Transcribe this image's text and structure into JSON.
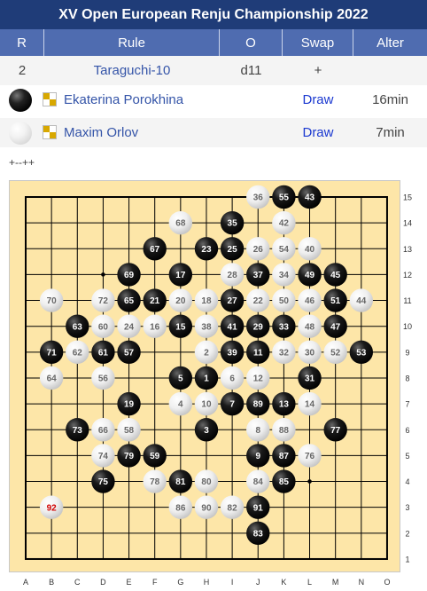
{
  "title": "XV Open European Renju Championship 2022",
  "headers": [
    "R",
    "Rule",
    "O",
    "Swap",
    "Alter"
  ],
  "info_row": {
    "round": "2",
    "rule": "Taraguchi-10",
    "opening": "d11",
    "swap": "+",
    "alter": ""
  },
  "players": [
    {
      "color": "black",
      "name": "Ekaterina Porokhina",
      "result": "Draw",
      "time": "16min"
    },
    {
      "color": "white",
      "name": "Maxim Orlov",
      "result": "Draw",
      "time": "7min"
    }
  ],
  "controls": {
    "expand": "+--++"
  },
  "board": {
    "columns": [
      "A",
      "B",
      "C",
      "D",
      "E",
      "F",
      "G",
      "H",
      "I",
      "J",
      "K",
      "L",
      "M",
      "N",
      "O"
    ],
    "rows": [
      "15",
      "14",
      "13",
      "12",
      "11",
      "10",
      "9",
      "8",
      "7",
      "6",
      "5",
      "4",
      "3",
      "2",
      "1"
    ],
    "colors": {
      "board_bg": "#fde6a8",
      "line": "#000000",
      "black_stone": "#111111",
      "white_stone": "#f0f0f0",
      "last_move_text": "#d00000"
    },
    "star_points": [
      "D12",
      "L12",
      "H8",
      "D4",
      "L4"
    ],
    "moves": [
      {
        "n": 1,
        "pos": "h8"
      },
      {
        "n": 2,
        "pos": "h9"
      },
      {
        "n": 3,
        "pos": "h6"
      },
      {
        "n": 4,
        "pos": "g7"
      },
      {
        "n": 5,
        "pos": "g8"
      },
      {
        "n": 6,
        "pos": "i8"
      },
      {
        "n": 7,
        "pos": "i7"
      },
      {
        "n": 8,
        "pos": "j6"
      },
      {
        "n": 9,
        "pos": "j5"
      },
      {
        "n": 10,
        "pos": "h7"
      },
      {
        "n": 11,
        "pos": "j9"
      },
      {
        "n": 12,
        "pos": "j8"
      },
      {
        "n": 13,
        "pos": "k7"
      },
      {
        "n": 14,
        "pos": "l7"
      },
      {
        "n": 15,
        "pos": "g10"
      },
      {
        "n": 16,
        "pos": "f10"
      },
      {
        "n": 17,
        "pos": "g12"
      },
      {
        "n": 18,
        "pos": "h11"
      },
      {
        "n": 19,
        "pos": "e7"
      },
      {
        "n": 20,
        "pos": "g11"
      },
      {
        "n": 21,
        "pos": "f11"
      },
      {
        "n": 22,
        "pos": "j11"
      },
      {
        "n": 23,
        "pos": "h13"
      },
      {
        "n": 24,
        "pos": "e10"
      },
      {
        "n": 25,
        "pos": "i13"
      },
      {
        "n": 26,
        "pos": "j13"
      },
      {
        "n": 27,
        "pos": "i11"
      },
      {
        "n": 28,
        "pos": "i12"
      },
      {
        "n": 29,
        "pos": "j10"
      },
      {
        "n": 30,
        "pos": "l9"
      },
      {
        "n": 31,
        "pos": "l8"
      },
      {
        "n": 32,
        "pos": "k9"
      },
      {
        "n": 33,
        "pos": "k10"
      },
      {
        "n": 34,
        "pos": "k12"
      },
      {
        "n": 35,
        "pos": "i14"
      },
      {
        "n": 36,
        "pos": "j15"
      },
      {
        "n": 37,
        "pos": "j12"
      },
      {
        "n": 38,
        "pos": "h10"
      },
      {
        "n": 39,
        "pos": "i9"
      },
      {
        "n": 40,
        "pos": "l13"
      },
      {
        "n": 41,
        "pos": "i10"
      },
      {
        "n": 42,
        "pos": "k14"
      },
      {
        "n": 43,
        "pos": "l15"
      },
      {
        "n": 44,
        "pos": "n11"
      },
      {
        "n": 45,
        "pos": "m12"
      },
      {
        "n": 46,
        "pos": "l11"
      },
      {
        "n": 47,
        "pos": "m10"
      },
      {
        "n": 48,
        "pos": "l10"
      },
      {
        "n": 49,
        "pos": "l12"
      },
      {
        "n": 50,
        "pos": "k11"
      },
      {
        "n": 51,
        "pos": "m11"
      },
      {
        "n": 52,
        "pos": "m9"
      },
      {
        "n": 53,
        "pos": "n9"
      },
      {
        "n": 54,
        "pos": "k13"
      },
      {
        "n": 55,
        "pos": "k15"
      },
      {
        "n": 56,
        "pos": "d8"
      },
      {
        "n": 57,
        "pos": "e9"
      },
      {
        "n": 58,
        "pos": "e6"
      },
      {
        "n": 59,
        "pos": "f5"
      },
      {
        "n": 60,
        "pos": "d10"
      },
      {
        "n": 61,
        "pos": "d9"
      },
      {
        "n": 62,
        "pos": "c9"
      },
      {
        "n": 63,
        "pos": "c10"
      },
      {
        "n": 64,
        "pos": "b8"
      },
      {
        "n": 65,
        "pos": "e11"
      },
      {
        "n": 66,
        "pos": "d6"
      },
      {
        "n": 67,
        "pos": "f13"
      },
      {
        "n": 68,
        "pos": "g14"
      },
      {
        "n": 69,
        "pos": "e12"
      },
      {
        "n": 70,
        "pos": "b11"
      },
      {
        "n": 71,
        "pos": "b9"
      },
      {
        "n": 72,
        "pos": "d11"
      },
      {
        "n": 73,
        "pos": "c6"
      },
      {
        "n": 74,
        "pos": "d5"
      },
      {
        "n": 75,
        "pos": "d4"
      },
      {
        "n": 76,
        "pos": "l5"
      },
      {
        "n": 77,
        "pos": "m6"
      },
      {
        "n": 78,
        "pos": "f4"
      },
      {
        "n": 79,
        "pos": "e5"
      },
      {
        "n": 80,
        "pos": "h4"
      },
      {
        "n": 81,
        "pos": "g4"
      },
      {
        "n": 82,
        "pos": "i3"
      },
      {
        "n": 83,
        "pos": "j2"
      },
      {
        "n": 84,
        "pos": "j4"
      },
      {
        "n": 85,
        "pos": "k4"
      },
      {
        "n": 86,
        "pos": "g3"
      },
      {
        "n": 87,
        "pos": "k5"
      },
      {
        "n": 88,
        "pos": "k6"
      },
      {
        "n": 89,
        "pos": "j7"
      },
      {
        "n": 90,
        "pos": "h3"
      },
      {
        "n": 91,
        "pos": "j3"
      },
      {
        "n": 92,
        "pos": "b3"
      }
    ]
  }
}
